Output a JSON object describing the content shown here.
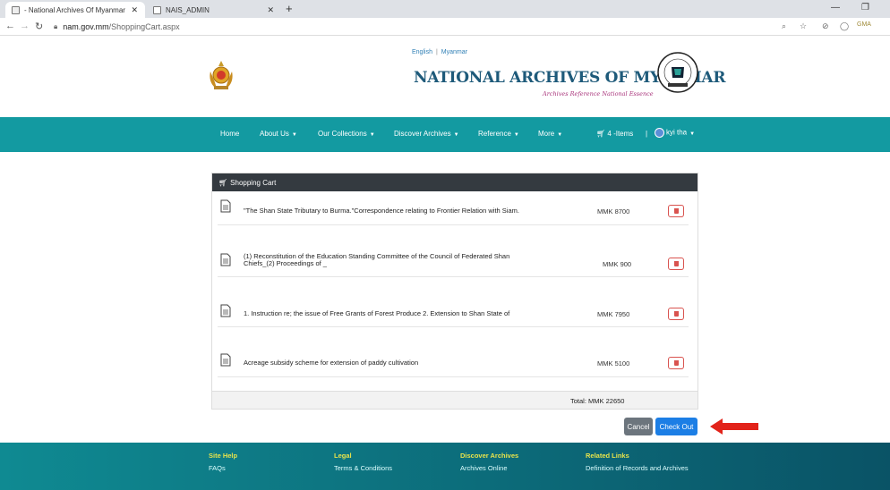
{
  "browser": {
    "tabs": [
      {
        "label": "- National Archives Of Myanmar",
        "active": true
      },
      {
        "label": "NAIS_ADMIN",
        "active": false
      }
    ],
    "url_domain": "nam.gov.mm",
    "url_path": "/ShoppingCart.aspx",
    "profile_label": "GMA"
  },
  "header": {
    "lang_english": "English",
    "lang_sep": "|",
    "lang_myanmar": "Myanmar",
    "title": "NATIONAL ARCHIVES OF MYANMAR",
    "tagline": "Archives Reference National Essence"
  },
  "nav": {
    "home": "Home",
    "about": "About Us",
    "collections": "Our Collections",
    "discover": "Discover Archives",
    "reference": "Reference",
    "more": "More",
    "cart": "4 -Items",
    "sep": "|",
    "user": "kyi tha"
  },
  "cart": {
    "heading": "Shopping Cart",
    "items": [
      {
        "title": "\"The Shan State Tributary to Burma.\"Correspondence relating to Frontier Relation with Siam.",
        "price": "MMK 8700"
      },
      {
        "title": "(1) Reconstitution of the Education Standing Committee of the Council of Federated Shan",
        "title2": "Chiefs_(2) Proceedings of _",
        "price": "MMK 900"
      },
      {
        "title": "1. Instruction re; the issue of Free Grants of Forest Produce 2. Extension to Shan State of",
        "price": "MMK 7950"
      },
      {
        "title": "Acreage subsidy scheme for extension of paddy cultivation",
        "price": "MMK 5100"
      }
    ],
    "total_label": "Total:",
    "total_value": "MMK 22650",
    "cancel": "Cancel",
    "checkout": "Check Out"
  },
  "footer": {
    "site_help": "Site Help",
    "faqs": "FAQs",
    "legal": "Legal",
    "terms": "Terms & Conditions",
    "discover": "Discover Archives",
    "archives_online": "Archives Online",
    "related": "Related Links",
    "definition": "Definition of Records and Archives"
  },
  "colors": {
    "nav": "#139aa1",
    "title": "#1e5a7a",
    "checkout": "#1c7ee5",
    "delete": "#d9534f",
    "arrow": "#e2231a"
  }
}
